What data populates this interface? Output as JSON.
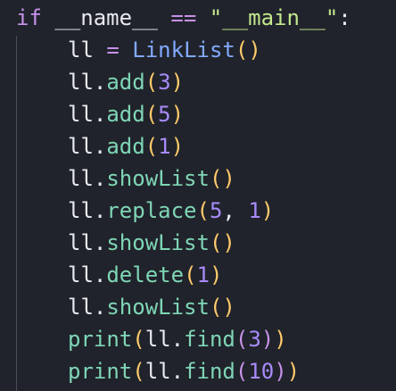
{
  "code": {
    "line1": {
      "kw": "if",
      "name": "__name__",
      "op": "==",
      "q1": "\"",
      "str": "__main__",
      "q2": "\"",
      "colon": ":"
    },
    "line2": {
      "var": "ll",
      "eq": "=",
      "cls": "LinkList",
      "open": "(",
      "close": ")"
    },
    "line3": {
      "var": "ll",
      "dot": ".",
      "fn": "add",
      "open": "(",
      "arg": "3",
      "close": ")"
    },
    "line4": {
      "var": "ll",
      "dot": ".",
      "fn": "add",
      "open": "(",
      "arg": "5",
      "close": ")"
    },
    "line5": {
      "var": "ll",
      "dot": ".",
      "fn": "add",
      "open": "(",
      "arg": "1",
      "close": ")"
    },
    "line6": {
      "var": "ll",
      "dot": ".",
      "fn": "showList",
      "open": "(",
      "close": ")"
    },
    "line7": {
      "var": "ll",
      "dot": ".",
      "fn": "replace",
      "open": "(",
      "arg1": "5",
      "comma": ",",
      "arg2": "1",
      "close": ")"
    },
    "line8": {
      "var": "ll",
      "dot": ".",
      "fn": "showList",
      "open": "(",
      "close": ")"
    },
    "line9": {
      "var": "ll",
      "dot": ".",
      "fn": "delete",
      "open": "(",
      "arg": "1",
      "close": ")"
    },
    "line10": {
      "var": "ll",
      "dot": ".",
      "fn": "showList",
      "open": "(",
      "close": ")"
    },
    "line11": {
      "fn": "print",
      "open": "(",
      "var": "ll",
      "dot": ".",
      "fn2": "find",
      "open2": "(",
      "arg": "3",
      "close2": ")",
      "close": ")"
    },
    "line12": {
      "fn": "print",
      "open": "(",
      "var": "ll",
      "dot": ".",
      "fn2": "find",
      "open2": "(",
      "arg": "10",
      "close2": ")",
      "close": ")"
    }
  },
  "colors": {
    "background": "#20232b",
    "keyword": "#c792ea",
    "string": "#c3e88d",
    "class": "#82aaff",
    "function": "#7fd6b5",
    "paren": "#ffcb6b",
    "number": "#a78bfa",
    "text": "#e8eaf0"
  }
}
